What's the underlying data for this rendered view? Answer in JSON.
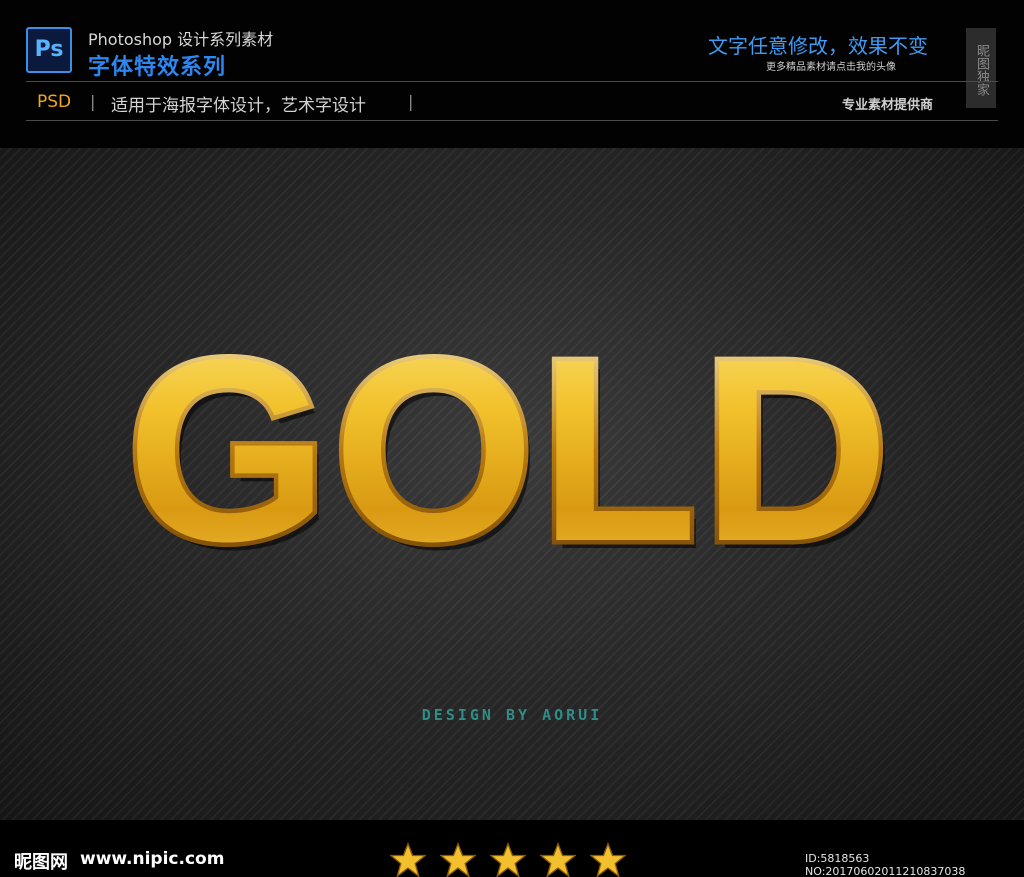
{
  "header": {
    "app_logo_text": "Ps",
    "series_title": "Photoshop 设计系列素材",
    "series_subtitle": "字体特效系列",
    "tagline_main": "文字任意修改，效果不变",
    "tagline_sub": "更多精品素材请点击我的头像",
    "exclusive_badge": "昵图独家",
    "format_label": "PSD",
    "divider": "|",
    "usage_text": "适用于海报字体设计，艺术字设计",
    "provider_text": "专业素材提供商"
  },
  "main": {
    "headline": "GOLD",
    "credit": "DESIGN BY AORUI"
  },
  "footer": {
    "site_logo": "昵图网",
    "site_url": "www.nipic.com",
    "rating": 5,
    "image_id": "ID:5818563 NO:20170602011210837038"
  },
  "colors": {
    "accent_blue": "#2e86f0",
    "psd_orange": "#f0a81a",
    "gold_light": "#f5d24a",
    "gold_dark": "#a86a0a",
    "credit_teal": "#2f8c86"
  }
}
